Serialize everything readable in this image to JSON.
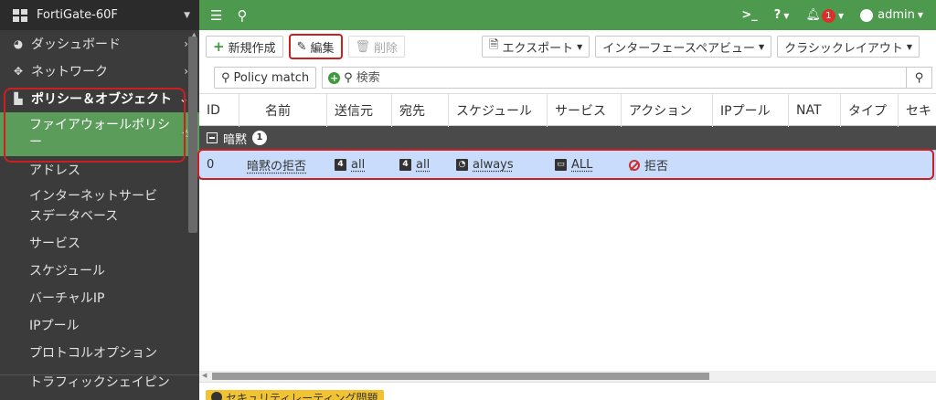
{
  "device": {
    "name": "FortiGate-60F"
  },
  "sidebar": {
    "items": [
      {
        "label": "ダッシュボード",
        "icon": "dashboard-icon"
      },
      {
        "label": "ネットワーク",
        "icon": "network-icon"
      },
      {
        "label": "ポリシー＆オブジェクト",
        "icon": "policy-icon"
      }
    ],
    "subitems": [
      {
        "label": "ファイアウォールポリシー"
      },
      {
        "label": "アドレス"
      },
      {
        "label": "インターネットサービスデータベース",
        "line1": "インターネットサービ",
        "line2": "スデータベース"
      },
      {
        "label": "サービス"
      },
      {
        "label": "スケジュール"
      },
      {
        "label": "バーチャルIP"
      },
      {
        "label": "IPプール"
      },
      {
        "label": "プロトコルオプション"
      },
      {
        "label": "トラフィックシェイピン"
      }
    ]
  },
  "topbar": {
    "notification_count": "1",
    "user": "admin"
  },
  "toolbar": {
    "new_label": "新規作成",
    "edit_label": "編集",
    "delete_label": "削除",
    "export_label": "エクスポート",
    "interface_pair_view_label": "インターフェースペアビュー",
    "classic_layout_label": "クラシックレイアウト"
  },
  "search": {
    "policy_match_label": "Policy match",
    "placeholder": "検索"
  },
  "table": {
    "columns": [
      "ID",
      "名前",
      "送信元",
      "宛先",
      "スケジュール",
      "サービス",
      "アクション",
      "IPプール",
      "NAT",
      "タイプ",
      "セキ"
    ],
    "group": {
      "label": "暗黙",
      "count": "1"
    },
    "rows": [
      {
        "id": "0",
        "name": "暗黙の拒否",
        "source": "all",
        "destination": "all",
        "schedule": "always",
        "service": "ALL",
        "action": "拒否",
        "ip_pool": "",
        "nat": "",
        "type": ""
      }
    ]
  },
  "bottom": {
    "tag_label": "セキュリティレーティング問題"
  },
  "colors": {
    "accent_green": "#4d9a4f",
    "highlight_red": "#cc1f1f",
    "row_selected": "#c9dcfb"
  }
}
